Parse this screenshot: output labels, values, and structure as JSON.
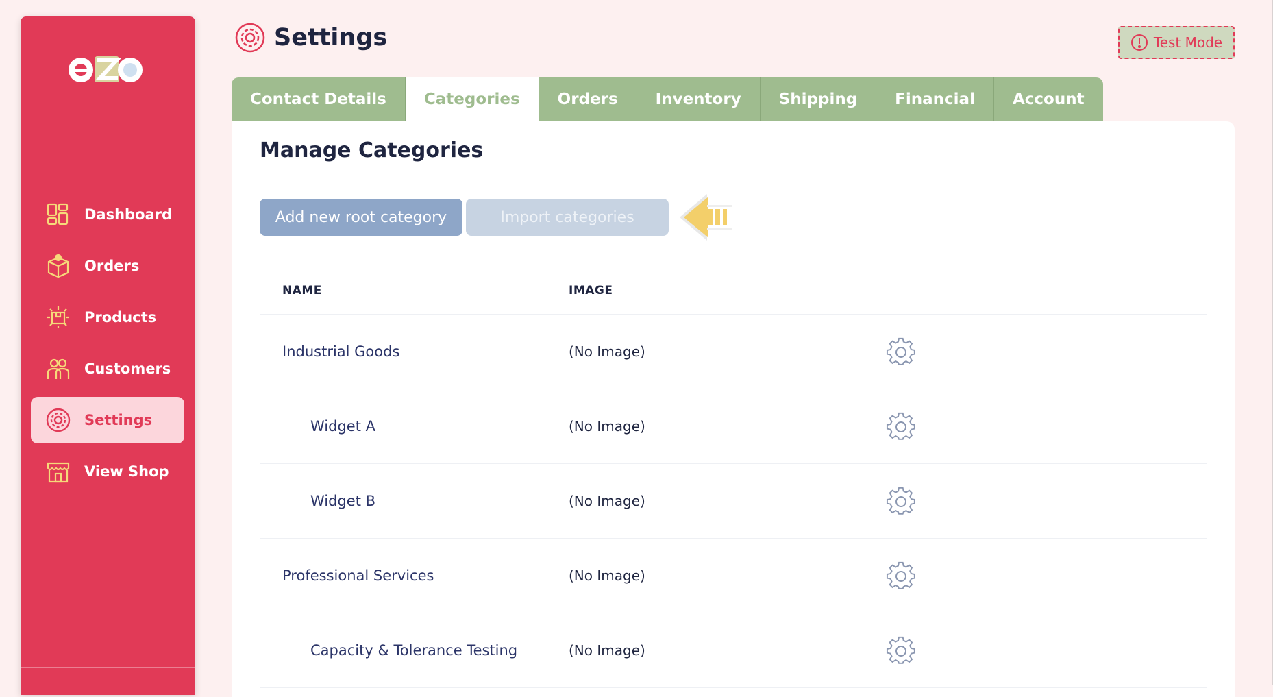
{
  "app": {
    "logo_text": "eZe",
    "test_mode_label": "Test Mode",
    "test_mode_icon": "alert-circle-icon"
  },
  "sidebar": {
    "items": [
      {
        "label": "Dashboard",
        "icon": "dashboard-icon",
        "active": false
      },
      {
        "label": "Orders",
        "icon": "box-icon",
        "active": false
      },
      {
        "label": "Products",
        "icon": "product-icon",
        "active": false
      },
      {
        "label": "Customers",
        "icon": "customers-icon",
        "active": false
      },
      {
        "label": "Settings",
        "icon": "settings-icon",
        "active": true
      },
      {
        "label": "View Shop",
        "icon": "shop-icon",
        "active": false
      }
    ]
  },
  "header": {
    "title": "Settings",
    "icon": "settings-icon"
  },
  "tabs": [
    {
      "label": "Contact Details",
      "active": false
    },
    {
      "label": "Categories",
      "active": true
    },
    {
      "label": "Orders",
      "active": false
    },
    {
      "label": "Inventory",
      "active": false
    },
    {
      "label": "Shipping",
      "active": false
    },
    {
      "label": "Financial",
      "active": false
    },
    {
      "label": "Account",
      "active": false
    }
  ],
  "main": {
    "title": "Manage Categories",
    "add_button_label": "Add new root category",
    "import_button_label": "Import categories",
    "hint_icon": "arrow-left-icon",
    "table": {
      "columns": [
        "NAME",
        "IMAGE",
        ""
      ],
      "rows": [
        {
          "name": "Industrial Goods",
          "image": "(No Image)",
          "level": 0
        },
        {
          "name": "Widget A",
          "image": "(No Image)",
          "level": 1
        },
        {
          "name": "Widget B",
          "image": "(No Image)",
          "level": 1
        },
        {
          "name": "Professional Services",
          "image": "(No Image)",
          "level": 0
        },
        {
          "name": "Capacity & Tolerance Testing",
          "image": "(No Image)",
          "level": 1
        }
      ]
    }
  },
  "colors": {
    "brand_red": "#e13a57",
    "tab_green": "#9fbc8f",
    "button_blue": "#8ea6c8",
    "arrow_yellow": "#f3cf6a"
  }
}
